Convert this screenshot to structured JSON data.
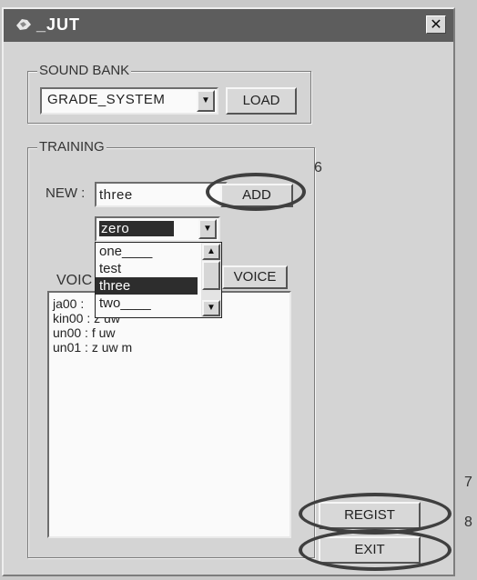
{
  "window": {
    "title": "_JUT",
    "close_glyph": "✕"
  },
  "sound_bank": {
    "legend": "SOUND BANK",
    "selected": "GRADE_SYSTEM",
    "load_label": "LOAD"
  },
  "training": {
    "legend": "TRAINING",
    "new_label": "NEW :",
    "new_value": "three",
    "add_label": "ADD",
    "combo_selected": "zero",
    "dropdown_items": [
      "one____",
      "test",
      "three",
      "two____"
    ],
    "voice_label_left": "VOIC",
    "voice_button_label": "VOICE",
    "entries": [
      "ja00 :",
      "kin00 : z uw",
      "un00 : f uw",
      "un01 : z uw m"
    ]
  },
  "buttons": {
    "regist_label": "REGIST",
    "exit_label": "EXIT"
  },
  "annotations": {
    "six": "6",
    "seven": "7",
    "eight": "8"
  }
}
